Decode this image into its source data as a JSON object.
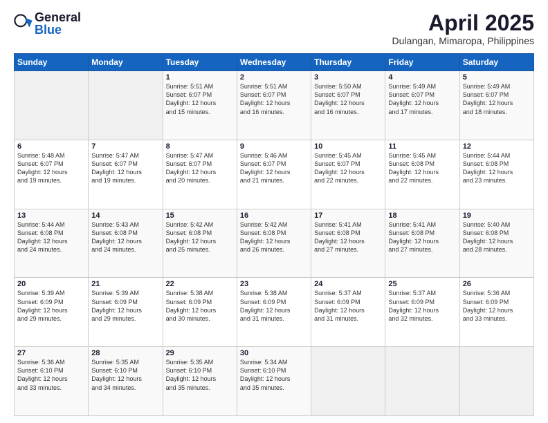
{
  "header": {
    "logo_general": "General",
    "logo_blue": "Blue",
    "month_year": "April 2025",
    "location": "Dulangan, Mimaropa, Philippines"
  },
  "days_of_week": [
    "Sunday",
    "Monday",
    "Tuesday",
    "Wednesday",
    "Thursday",
    "Friday",
    "Saturday"
  ],
  "weeks": [
    [
      {
        "day": "",
        "info": ""
      },
      {
        "day": "",
        "info": ""
      },
      {
        "day": "1",
        "info": "Sunrise: 5:51 AM\nSunset: 6:07 PM\nDaylight: 12 hours\nand 15 minutes."
      },
      {
        "day": "2",
        "info": "Sunrise: 5:51 AM\nSunset: 6:07 PM\nDaylight: 12 hours\nand 16 minutes."
      },
      {
        "day": "3",
        "info": "Sunrise: 5:50 AM\nSunset: 6:07 PM\nDaylight: 12 hours\nand 16 minutes."
      },
      {
        "day": "4",
        "info": "Sunrise: 5:49 AM\nSunset: 6:07 PM\nDaylight: 12 hours\nand 17 minutes."
      },
      {
        "day": "5",
        "info": "Sunrise: 5:49 AM\nSunset: 6:07 PM\nDaylight: 12 hours\nand 18 minutes."
      }
    ],
    [
      {
        "day": "6",
        "info": "Sunrise: 5:48 AM\nSunset: 6:07 PM\nDaylight: 12 hours\nand 19 minutes."
      },
      {
        "day": "7",
        "info": "Sunrise: 5:47 AM\nSunset: 6:07 PM\nDaylight: 12 hours\nand 19 minutes."
      },
      {
        "day": "8",
        "info": "Sunrise: 5:47 AM\nSunset: 6:07 PM\nDaylight: 12 hours\nand 20 minutes."
      },
      {
        "day": "9",
        "info": "Sunrise: 5:46 AM\nSunset: 6:07 PM\nDaylight: 12 hours\nand 21 minutes."
      },
      {
        "day": "10",
        "info": "Sunrise: 5:45 AM\nSunset: 6:07 PM\nDaylight: 12 hours\nand 22 minutes."
      },
      {
        "day": "11",
        "info": "Sunrise: 5:45 AM\nSunset: 6:08 PM\nDaylight: 12 hours\nand 22 minutes."
      },
      {
        "day": "12",
        "info": "Sunrise: 5:44 AM\nSunset: 6:08 PM\nDaylight: 12 hours\nand 23 minutes."
      }
    ],
    [
      {
        "day": "13",
        "info": "Sunrise: 5:44 AM\nSunset: 6:08 PM\nDaylight: 12 hours\nand 24 minutes."
      },
      {
        "day": "14",
        "info": "Sunrise: 5:43 AM\nSunset: 6:08 PM\nDaylight: 12 hours\nand 24 minutes."
      },
      {
        "day": "15",
        "info": "Sunrise: 5:42 AM\nSunset: 6:08 PM\nDaylight: 12 hours\nand 25 minutes."
      },
      {
        "day": "16",
        "info": "Sunrise: 5:42 AM\nSunset: 6:08 PM\nDaylight: 12 hours\nand 26 minutes."
      },
      {
        "day": "17",
        "info": "Sunrise: 5:41 AM\nSunset: 6:08 PM\nDaylight: 12 hours\nand 27 minutes."
      },
      {
        "day": "18",
        "info": "Sunrise: 5:41 AM\nSunset: 6:08 PM\nDaylight: 12 hours\nand 27 minutes."
      },
      {
        "day": "19",
        "info": "Sunrise: 5:40 AM\nSunset: 6:08 PM\nDaylight: 12 hours\nand 28 minutes."
      }
    ],
    [
      {
        "day": "20",
        "info": "Sunrise: 5:39 AM\nSunset: 6:09 PM\nDaylight: 12 hours\nand 29 minutes."
      },
      {
        "day": "21",
        "info": "Sunrise: 5:39 AM\nSunset: 6:09 PM\nDaylight: 12 hours\nand 29 minutes."
      },
      {
        "day": "22",
        "info": "Sunrise: 5:38 AM\nSunset: 6:09 PM\nDaylight: 12 hours\nand 30 minutes."
      },
      {
        "day": "23",
        "info": "Sunrise: 5:38 AM\nSunset: 6:09 PM\nDaylight: 12 hours\nand 31 minutes."
      },
      {
        "day": "24",
        "info": "Sunrise: 5:37 AM\nSunset: 6:09 PM\nDaylight: 12 hours\nand 31 minutes."
      },
      {
        "day": "25",
        "info": "Sunrise: 5:37 AM\nSunset: 6:09 PM\nDaylight: 12 hours\nand 32 minutes."
      },
      {
        "day": "26",
        "info": "Sunrise: 5:36 AM\nSunset: 6:09 PM\nDaylight: 12 hours\nand 33 minutes."
      }
    ],
    [
      {
        "day": "27",
        "info": "Sunrise: 5:36 AM\nSunset: 6:10 PM\nDaylight: 12 hours\nand 33 minutes."
      },
      {
        "day": "28",
        "info": "Sunrise: 5:35 AM\nSunset: 6:10 PM\nDaylight: 12 hours\nand 34 minutes."
      },
      {
        "day": "29",
        "info": "Sunrise: 5:35 AM\nSunset: 6:10 PM\nDaylight: 12 hours\nand 35 minutes."
      },
      {
        "day": "30",
        "info": "Sunrise: 5:34 AM\nSunset: 6:10 PM\nDaylight: 12 hours\nand 35 minutes."
      },
      {
        "day": "",
        "info": ""
      },
      {
        "day": "",
        "info": ""
      },
      {
        "day": "",
        "info": ""
      }
    ]
  ]
}
